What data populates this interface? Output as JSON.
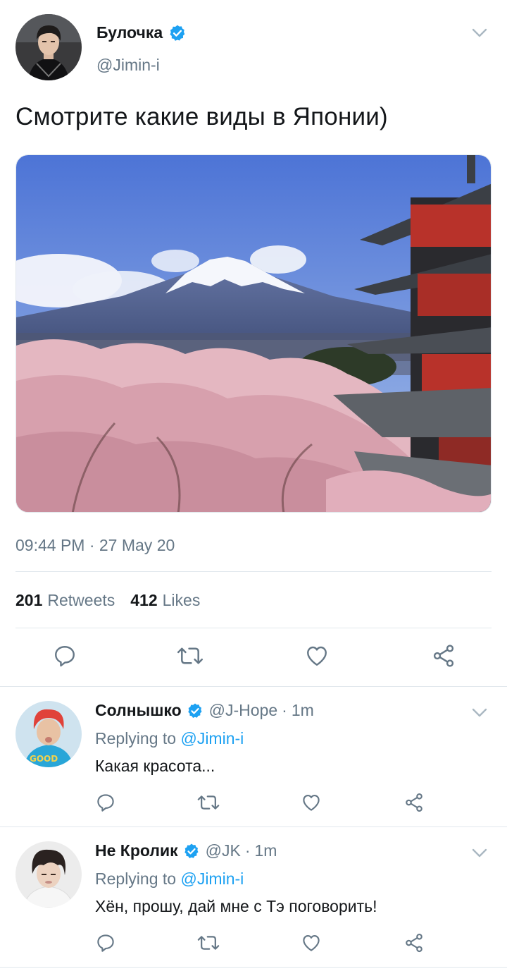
{
  "tweet": {
    "author_name": "Булочка",
    "author_handle": "@Jimin-i",
    "text": "Смотрите какие виды в Японии)",
    "timestamp": "09:44 PM · 27 May 20",
    "retweets_count": "201",
    "retweets_label": "Retweets",
    "likes_count": "412",
    "likes_label": "Likes"
  },
  "replies": [
    {
      "name": "Солнышко",
      "handle": "@J-Hope",
      "dot": "·",
      "time": "1m",
      "replying_prefix": "Replying to",
      "replying_to": "@Jimin-i",
      "text": "Какая красота..."
    },
    {
      "name": "Не Кролик",
      "handle": "@JK",
      "dot": "·",
      "time": "1m",
      "replying_prefix": "Replying to",
      "replying_to": "@Jimin-i",
      "text": "Хён, прошу, дай мне с Тэ поговорить!"
    }
  ],
  "icons": {
    "reply": "reply-icon",
    "retweet": "retweet-icon",
    "like": "heart-icon",
    "share": "share-icon",
    "verified": "verified-badge-icon",
    "more": "chevron-down-icon"
  },
  "colors": {
    "accent": "#1da1f2",
    "secondary_text": "#657786",
    "divider": "#e1e8ed"
  }
}
